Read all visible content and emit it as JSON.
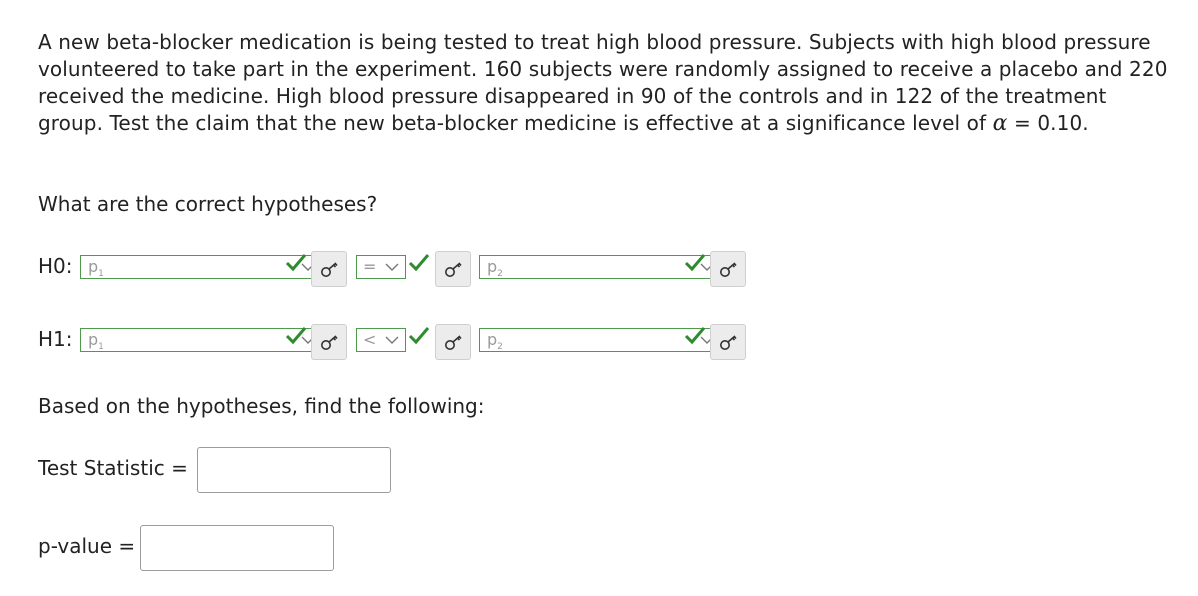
{
  "problem": {
    "text_before_alpha": "A new beta-blocker medication is being tested to treat high blood pressure. Subjects with high blood pressure volunteered to take part in the experiment. 160 subjects were randomly assigned to receive a placebo and 220 received the medicine. High blood pressure disappeared in 90 of the controls and in 122 of the treatment group. Test the claim that the new beta-blocker medicine is effective at a significance level of ",
    "alpha_symbol": "α",
    "text_after_alpha": " = 0.10."
  },
  "question": "What are the correct hypotheses?",
  "hypotheses": [
    {
      "label": "H0:",
      "left": {
        "symbol": "p",
        "subscript": "1"
      },
      "operator": "=",
      "right": {
        "symbol": "p",
        "subscript": "2"
      }
    },
    {
      "label": "H1:",
      "left": {
        "symbol": "p",
        "subscript": "1"
      },
      "operator": "<",
      "right": {
        "symbol": "p",
        "subscript": "2"
      }
    }
  ],
  "subheading": "Based on the hypotheses, find the following:",
  "test_statistic": {
    "label": "Test Statistic =",
    "value": ""
  },
  "p_value": {
    "label": "p-value =",
    "value": ""
  },
  "colors": {
    "correct": "#2e8b2e",
    "select_border": "#4d9a4d",
    "input_border": "#9c9c9c",
    "key_button_bg": "#ececec"
  },
  "icons": {
    "status": "checkmark-icon",
    "key": "key-icon",
    "dropdown": "chevron-down-icon"
  }
}
